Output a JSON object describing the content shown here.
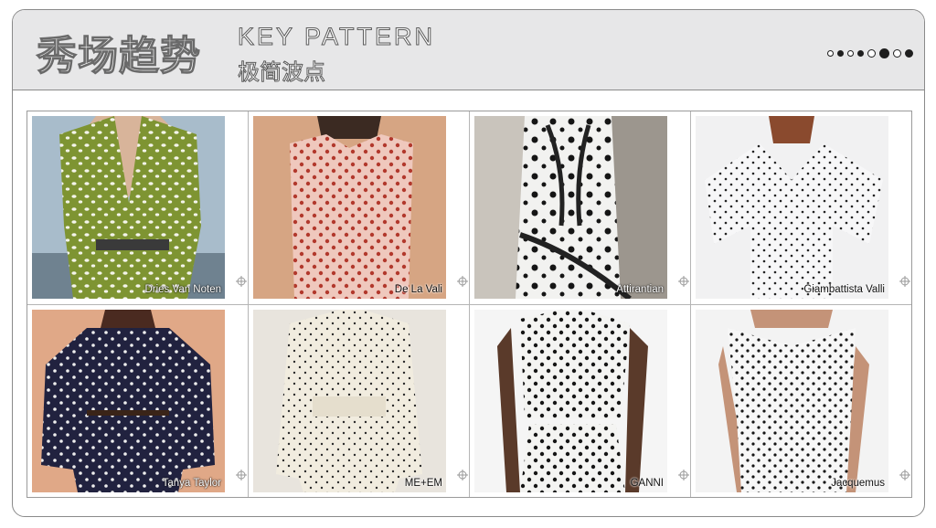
{
  "header": {
    "title_cn": "秀场趋势",
    "title_en": "KEY PATTERN",
    "subtitle_cn": "极简波点"
  },
  "colors": {
    "header_bg": "#e7e7e8",
    "frame": "#8a8a8a",
    "dot": "#1e1e1e"
  },
  "page_dots": [
    "small-open",
    "small-filled",
    "small-open",
    "small-filled",
    "medium-open",
    "large-filled",
    "medium-open",
    "medium-filled"
  ],
  "cards": [
    {
      "brand": "Dries Van Noten",
      "garment": "green dress with white dots"
    },
    {
      "brand": "De La Vali",
      "garment": "pink dress with red dots"
    },
    {
      "brand": "Attirantian",
      "garment": "white ruffle dress with black dots"
    },
    {
      "brand": "Giambattista Valli",
      "garment": "white sheer cape dress with black dots"
    },
    {
      "brand": "Tanya Taylor",
      "garment": "navy dress with white dots"
    },
    {
      "brand": "ME+EM",
      "garment": "cream blouse dress with black dots"
    },
    {
      "brand": "GANNI",
      "garment": "white top and skirt with black dots"
    },
    {
      "brand": "Jacquemus",
      "garment": "white off-shoulder dress with black dots"
    }
  ]
}
